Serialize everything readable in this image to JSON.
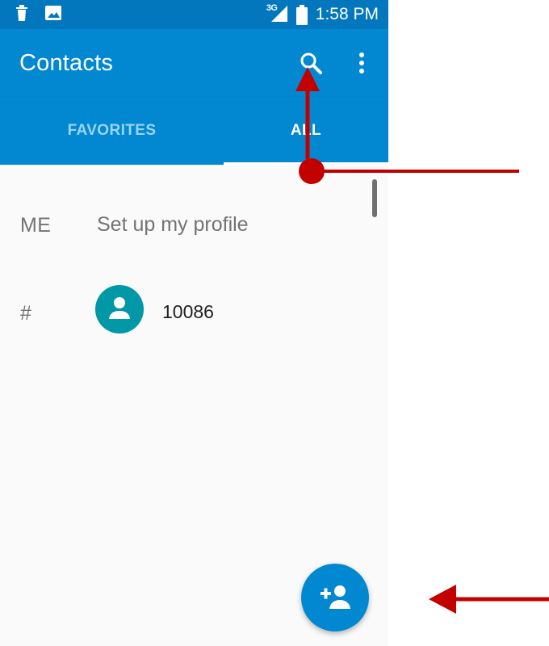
{
  "status_bar": {
    "network_type": "3G",
    "time": "1:58 PM",
    "icons": [
      "trash-icon",
      "image-icon",
      "signal-icon",
      "battery-icon"
    ]
  },
  "app_bar": {
    "title": "Contacts",
    "actions": [
      "search-icon",
      "more-vert-icon"
    ]
  },
  "tabs": [
    {
      "label": "FAVORITES",
      "selected": false
    },
    {
      "label": "ALL",
      "selected": true
    }
  ],
  "profile": {
    "section": "ME",
    "text": "Set up my profile"
  },
  "contacts": [
    {
      "section": "#",
      "name": "10086",
      "avatar_icon": "person-icon",
      "avatar_color": "#0097a7"
    }
  ],
  "fab": {
    "icon": "add-person-icon"
  },
  "colors": {
    "status_bar": "#0277bd",
    "app_bar": "#0288d1",
    "accent": "#0288d1",
    "avatar": "#0097a7",
    "annotation": "#c30000"
  },
  "annotations": {
    "arrows": [
      "search-annotation-arrow",
      "add-contact-annotation-arrow"
    ]
  }
}
